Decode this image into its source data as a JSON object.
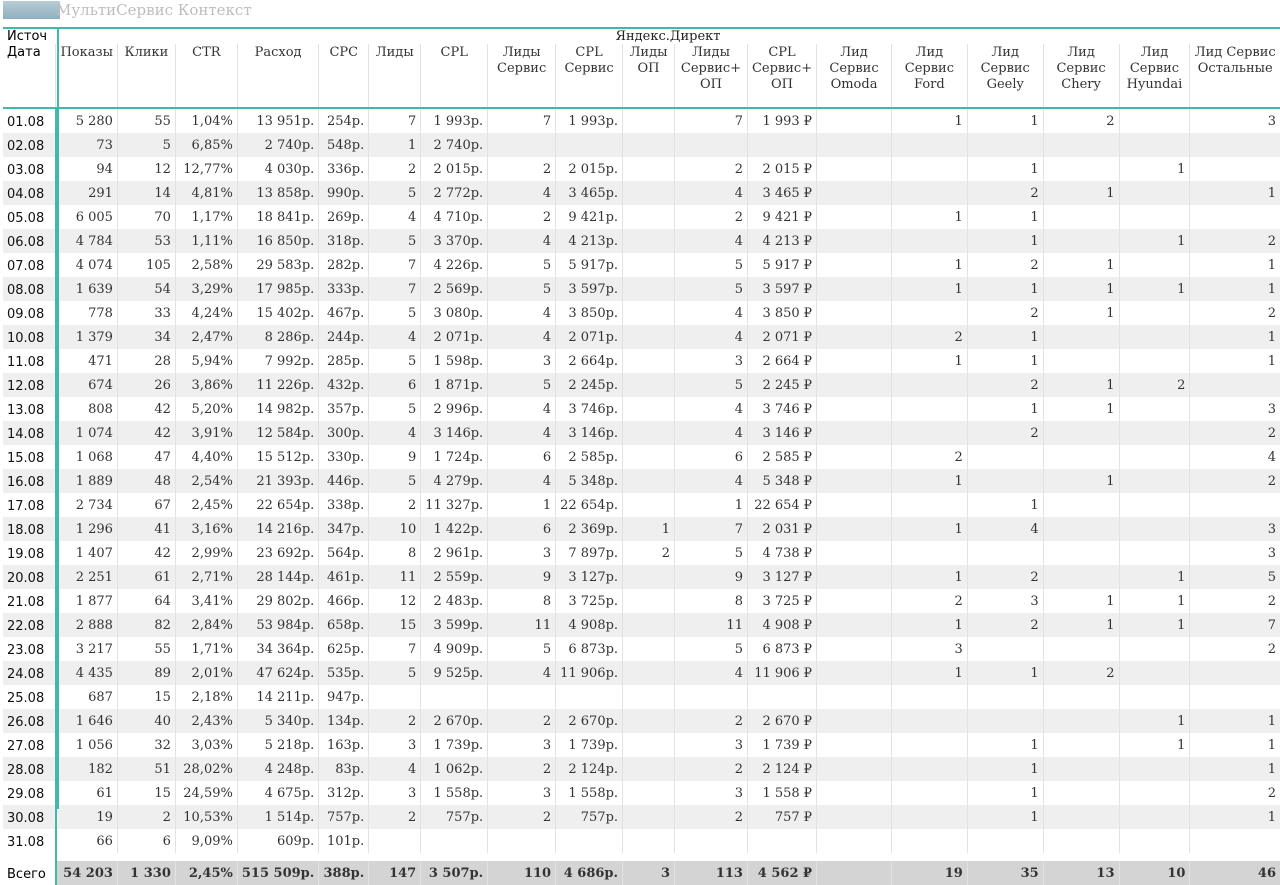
{
  "window": {
    "title": "МультиСервис Контекст"
  },
  "table": {
    "source_label": "Источ",
    "group_label": "Яндекс.Директ",
    "columns": [
      "Дата",
      "Показы",
      "Клики",
      "CTR",
      "Расход",
      "CPC",
      "Лиды",
      "CPL",
      "Лиды Сервис",
      "CPL Сервис",
      "Лиды ОП",
      "Лиды Сервис+ ОП",
      "CPL Сервис+ ОП",
      "Лид Сервис Omoda",
      "Лид Сервис Ford",
      "Лид Сервис Geely",
      "Лид Сервис Chery",
      "Лид Сервис Hyundai",
      "Лид Сервис Остальные"
    ],
    "rows": [
      [
        "01.08",
        "5 280",
        "55",
        "1,04%",
        "13 951р.",
        "254р.",
        "7",
        "1 993р.",
        "7",
        "1 993р.",
        "",
        "7",
        "1 993 ₽",
        "",
        "1",
        "1",
        "2",
        "",
        "3"
      ],
      [
        "02.08",
        "73",
        "5",
        "6,85%",
        "2 740р.",
        "548р.",
        "1",
        "2 740р.",
        "",
        "",
        "",
        "",
        "",
        "",
        "",
        "",
        "",
        "",
        ""
      ],
      [
        "03.08",
        "94",
        "12",
        "12,77%",
        "4 030р.",
        "336р.",
        "2",
        "2 015р.",
        "2",
        "2 015р.",
        "",
        "2",
        "2 015 ₽",
        "",
        "",
        "1",
        "",
        "1",
        ""
      ],
      [
        "04.08",
        "291",
        "14",
        "4,81%",
        "13 858р.",
        "990р.",
        "5",
        "2 772р.",
        "4",
        "3 465р.",
        "",
        "4",
        "3 465 ₽",
        "",
        "",
        "2",
        "1",
        "",
        "1"
      ],
      [
        "05.08",
        "6 005",
        "70",
        "1,17%",
        "18 841р.",
        "269р.",
        "4",
        "4 710р.",
        "2",
        "9 421р.",
        "",
        "2",
        "9 421 ₽",
        "",
        "1",
        "1",
        "",
        "",
        ""
      ],
      [
        "06.08",
        "4 784",
        "53",
        "1,11%",
        "16 850р.",
        "318р.",
        "5",
        "3 370р.",
        "4",
        "4 213р.",
        "",
        "4",
        "4 213 ₽",
        "",
        "",
        "1",
        "",
        "1",
        "2"
      ],
      [
        "07.08",
        "4 074",
        "105",
        "2,58%",
        "29 583р.",
        "282р.",
        "7",
        "4 226р.",
        "5",
        "5 917р.",
        "",
        "5",
        "5 917 ₽",
        "",
        "1",
        "2",
        "1",
        "",
        "1"
      ],
      [
        "08.08",
        "1 639",
        "54",
        "3,29%",
        "17 985р.",
        "333р.",
        "7",
        "2 569р.",
        "5",
        "3 597р.",
        "",
        "5",
        "3 597 ₽",
        "",
        "1",
        "1",
        "1",
        "1",
        "1"
      ],
      [
        "09.08",
        "778",
        "33",
        "4,24%",
        "15 402р.",
        "467р.",
        "5",
        "3 080р.",
        "4",
        "3 850р.",
        "",
        "4",
        "3 850 ₽",
        "",
        "",
        "2",
        "1",
        "",
        "2"
      ],
      [
        "10.08",
        "1 379",
        "34",
        "2,47%",
        "8 286р.",
        "244р.",
        "4",
        "2 071р.",
        "4",
        "2 071р.",
        "",
        "4",
        "2 071 ₽",
        "",
        "2",
        "1",
        "",
        "",
        "1"
      ],
      [
        "11.08",
        "471",
        "28",
        "5,94%",
        "7 992р.",
        "285р.",
        "5",
        "1 598р.",
        "3",
        "2 664р.",
        "",
        "3",
        "2 664 ₽",
        "",
        "1",
        "1",
        "",
        "",
        "1"
      ],
      [
        "12.08",
        "674",
        "26",
        "3,86%",
        "11 226р.",
        "432р.",
        "6",
        "1 871р.",
        "5",
        "2 245р.",
        "",
        "5",
        "2 245 ₽",
        "",
        "",
        "2",
        "1",
        "2",
        ""
      ],
      [
        "13.08",
        "808",
        "42",
        "5,20%",
        "14 982р.",
        "357р.",
        "5",
        "2 996р.",
        "4",
        "3 746р.",
        "",
        "4",
        "3 746 ₽",
        "",
        "",
        "1",
        "1",
        "",
        "3"
      ],
      [
        "14.08",
        "1 074",
        "42",
        "3,91%",
        "12 584р.",
        "300р.",
        "4",
        "3 146р.",
        "4",
        "3 146р.",
        "",
        "4",
        "3 146 ₽",
        "",
        "",
        "2",
        "",
        "",
        "2"
      ],
      [
        "15.08",
        "1 068",
        "47",
        "4,40%",
        "15 512р.",
        "330р.",
        "9",
        "1 724р.",
        "6",
        "2 585р.",
        "",
        "6",
        "2 585 ₽",
        "",
        "2",
        "",
        "",
        "",
        "4"
      ],
      [
        "16.08",
        "1 889",
        "48",
        "2,54%",
        "21 393р.",
        "446р.",
        "5",
        "4 279р.",
        "4",
        "5 348р.",
        "",
        "4",
        "5 348 ₽",
        "",
        "1",
        "",
        "1",
        "",
        "2"
      ],
      [
        "17.08",
        "2 734",
        "67",
        "2,45%",
        "22 654р.",
        "338р.",
        "2",
        "11 327р.",
        "1",
        "22 654р.",
        "",
        "1",
        "22 654 ₽",
        "",
        "",
        "1",
        "",
        "",
        ""
      ],
      [
        "18.08",
        "1 296",
        "41",
        "3,16%",
        "14 216р.",
        "347р.",
        "10",
        "1 422р.",
        "6",
        "2 369р.",
        "1",
        "7",
        "2 031 ₽",
        "",
        "1",
        "4",
        "",
        "",
        "3"
      ],
      [
        "19.08",
        "1 407",
        "42",
        "2,99%",
        "23 692р.",
        "564р.",
        "8",
        "2 961р.",
        "3",
        "7 897р.",
        "2",
        "5",
        "4 738 ₽",
        "",
        "",
        "",
        "",
        "",
        "3"
      ],
      [
        "20.08",
        "2 251",
        "61",
        "2,71%",
        "28 144р.",
        "461р.",
        "11",
        "2 559р.",
        "9",
        "3 127р.",
        "",
        "9",
        "3 127 ₽",
        "",
        "1",
        "2",
        "",
        "1",
        "5"
      ],
      [
        "21.08",
        "1 877",
        "64",
        "3,41%",
        "29 802р.",
        "466р.",
        "12",
        "2 483р.",
        "8",
        "3 725р.",
        "",
        "8",
        "3 725 ₽",
        "",
        "2",
        "3",
        "1",
        "1",
        "2"
      ],
      [
        "22.08",
        "2 888",
        "82",
        "2,84%",
        "53 984р.",
        "658р.",
        "15",
        "3 599р.",
        "11",
        "4 908р.",
        "",
        "11",
        "4 908 ₽",
        "",
        "1",
        "2",
        "1",
        "1",
        "7"
      ],
      [
        "23.08",
        "3 217",
        "55",
        "1,71%",
        "34 364р.",
        "625р.",
        "7",
        "4 909р.",
        "5",
        "6 873р.",
        "",
        "5",
        "6 873 ₽",
        "",
        "3",
        "",
        "",
        "",
        "2"
      ],
      [
        "24.08",
        "4 435",
        "89",
        "2,01%",
        "47 624р.",
        "535р.",
        "5",
        "9 525р.",
        "4",
        "11 906р.",
        "",
        "4",
        "11 906 ₽",
        "",
        "1",
        "1",
        "2",
        "",
        ""
      ],
      [
        "25.08",
        "687",
        "15",
        "2,18%",
        "14 211р.",
        "947р.",
        "",
        "",
        "",
        "",
        "",
        "",
        "",
        "",
        "",
        "",
        "",
        "",
        ""
      ],
      [
        "26.08",
        "1 646",
        "40",
        "2,43%",
        "5 340р.",
        "134р.",
        "2",
        "2 670р.",
        "2",
        "2 670р.",
        "",
        "2",
        "2 670 ₽",
        "",
        "",
        "",
        "",
        "1",
        "1"
      ],
      [
        "27.08",
        "1 056",
        "32",
        "3,03%",
        "5 218р.",
        "163р.",
        "3",
        "1 739р.",
        "3",
        "1 739р.",
        "",
        "3",
        "1 739 ₽",
        "",
        "",
        "1",
        "",
        "1",
        "1"
      ],
      [
        "28.08",
        "182",
        "51",
        "28,02%",
        "4 248р.",
        "83р.",
        "4",
        "1 062р.",
        "2",
        "2 124р.",
        "",
        "2",
        "2 124 ₽",
        "",
        "",
        "1",
        "",
        "",
        "1"
      ],
      [
        "29.08",
        "61",
        "15",
        "24,59%",
        "4 675р.",
        "312р.",
        "3",
        "1 558р.",
        "3",
        "1 558р.",
        "",
        "3",
        "1 558 ₽",
        "",
        "",
        "1",
        "",
        "",
        "2"
      ],
      [
        "30.08",
        "19",
        "2",
        "10,53%",
        "1 514р.",
        "757р.",
        "2",
        "757р.",
        "2",
        "757р.",
        "",
        "2",
        "757 ₽",
        "",
        "",
        "1",
        "",
        "",
        "1"
      ],
      [
        "31.08",
        "66",
        "6",
        "9,09%",
        "609р.",
        "101р.",
        "",
        "",
        "",
        "",
        "",
        "",
        "",
        "",
        "",
        "",
        "",
        "",
        ""
      ]
    ],
    "total": [
      "Всего",
      "54 203",
      "1 330",
      "2,45%",
      "515 509р.",
      "388р.",
      "147",
      "3 507р.",
      "110",
      "4 686р.",
      "3",
      "113",
      "4 562 ₽",
      "",
      "19",
      "35",
      "13",
      "10",
      "46"
    ]
  },
  "colors": {
    "accent": "#3fb9aa",
    "stripe": "#efefef",
    "total_bg": "#d4d4d4"
  }
}
